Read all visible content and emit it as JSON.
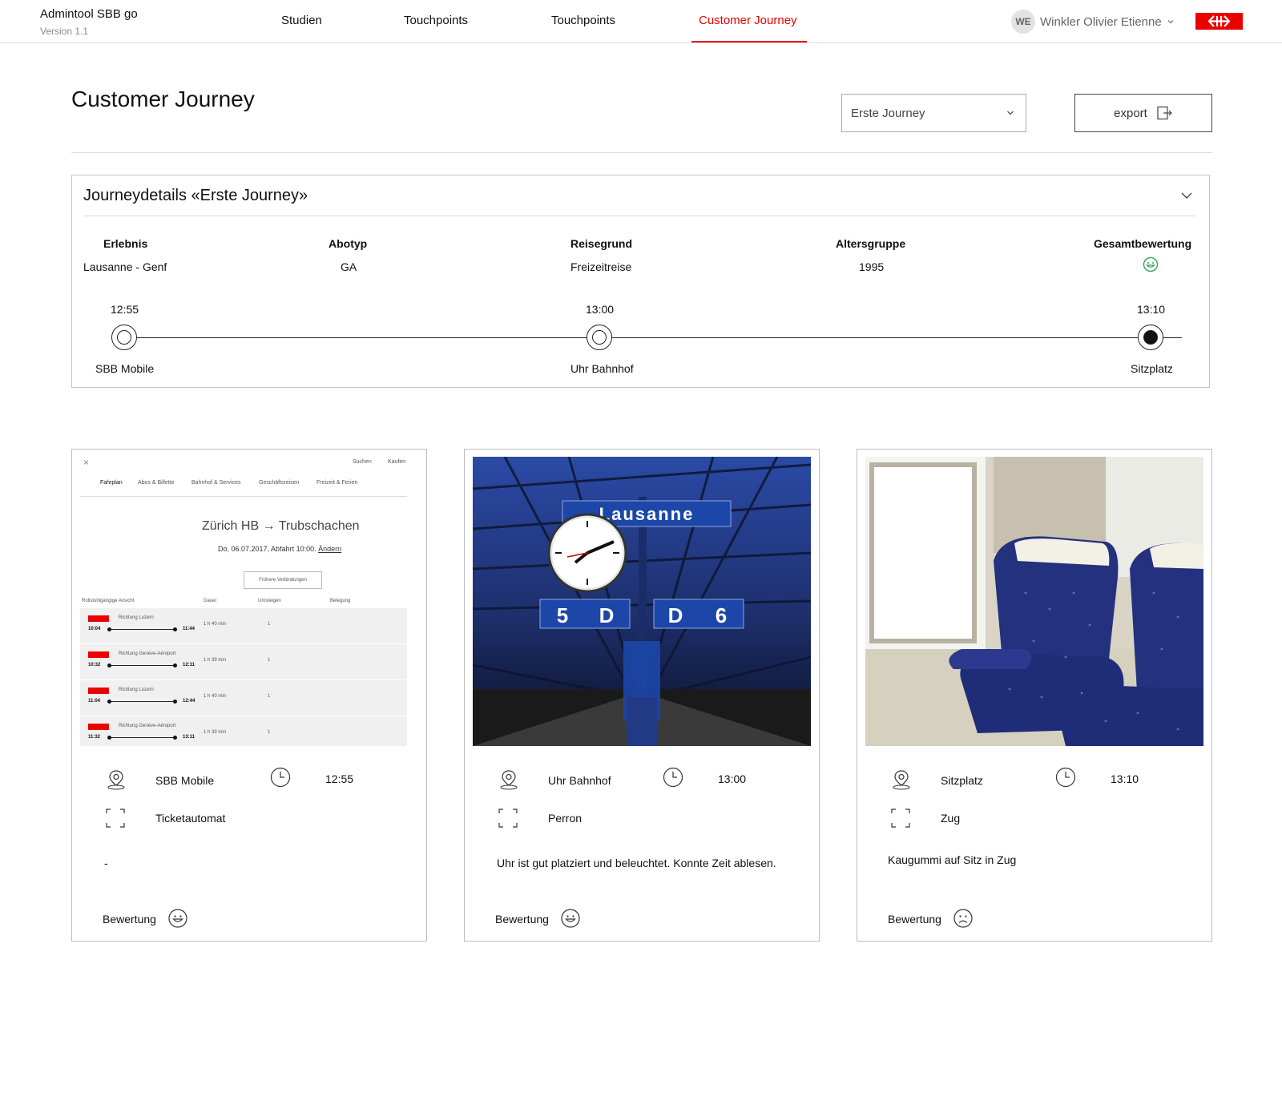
{
  "header": {
    "app_name": "Admintool SBB go",
    "version": "Version 1.1",
    "nav": [
      {
        "label": "Studien"
      },
      {
        "label": "Touchpoints"
      },
      {
        "label": "Touchpoints"
      },
      {
        "label": "Customer Journey"
      }
    ],
    "active_nav": "Customer Journey",
    "user": {
      "initials": "WE",
      "name": "Winkler Olivier Etienne"
    }
  },
  "colors": {
    "accent": "#eb0000",
    "positive": "#2e9d4a",
    "border": "#c6c6c6"
  },
  "page": {
    "title": "Customer Journey",
    "journey_select": {
      "value": "Erste Journey"
    },
    "export_label": "export"
  },
  "details": {
    "title": "Journeydetails «Erste Journey»",
    "columns": [
      {
        "label": "Erlebnis",
        "value": "Lausanne - Genf"
      },
      {
        "label": "Abotyp",
        "value": "GA"
      },
      {
        "label": "Reisegrund",
        "value": "Freizeitreise"
      },
      {
        "label": "Altersgruppe",
        "value": "1995"
      },
      {
        "label": "Gesamtbewertung",
        "icon": "smiley-happy-icon"
      }
    ],
    "timeline": [
      {
        "time": "12:55",
        "name": "SBB Mobile",
        "filled": false
      },
      {
        "time": "13:00",
        "name": "Uhr Bahnhof",
        "filled": false
      },
      {
        "time": "13:10",
        "name": "Sitzplatz",
        "filled": true
      }
    ]
  },
  "cards": [
    {
      "location": "SBB Mobile",
      "time": "12:55",
      "category": "Ticketautomat",
      "comment": "-",
      "rating_label": "Bewertung",
      "rating": "smiley-happy-icon",
      "image": {
        "search": "Suchen",
        "buy": "Kaufen",
        "tabs": [
          "Fahrplan",
          "Abos & Billette",
          "Bahnhof & Services",
          "Geschäftsreisen",
          "Freizeit & Ferien"
        ],
        "route": "Zürich HB → Trubschachen",
        "date_line": "Do, 06.07.2017, Abfahrt 10:00.",
        "change_link": "Ändern",
        "earlier": "Frühere Verbindungen",
        "columns": [
          "Rollstuhlgängige Ansicht",
          "Dauer",
          "Umsteigen",
          "Belegung"
        ],
        "connections": [
          {
            "direction": "Richtung Luzern",
            "dep": "10:04",
            "arr": "11:44",
            "duration": "1 h 40 min",
            "changes": "1"
          },
          {
            "direction": "Richtung Genève-Aéroport",
            "dep": "10:32",
            "arr": "12:11",
            "duration": "1 h 39 min",
            "changes": "1"
          },
          {
            "direction": "Richtung Luzern",
            "dep": "11:04",
            "arr": "12:44",
            "duration": "1 h 40 min",
            "changes": "1"
          },
          {
            "direction": "Richtung Genève-Aéroport",
            "dep": "11:32",
            "arr": "13:11",
            "duration": "1 h 39 min",
            "changes": "1"
          }
        ]
      }
    },
    {
      "location": "Uhr Bahnhof",
      "time": "13:00",
      "category": "Perron",
      "comment": "Uhr ist gut platziert und beleuchtet. Konnte Zeit ablesen.",
      "rating_label": "Bewertung",
      "rating": "smiley-happy-icon",
      "image": {
        "station_sign": "Lausanne",
        "platforms": [
          "5",
          "D",
          "D",
          "6"
        ]
      }
    },
    {
      "location": "Sitzplatz",
      "time": "13:10",
      "category": "Zug",
      "comment": "Kaugummi auf Sitz in Zug",
      "rating_label": "Bewertung",
      "rating": "smiley-sad-icon",
      "image": {}
    }
  ]
}
